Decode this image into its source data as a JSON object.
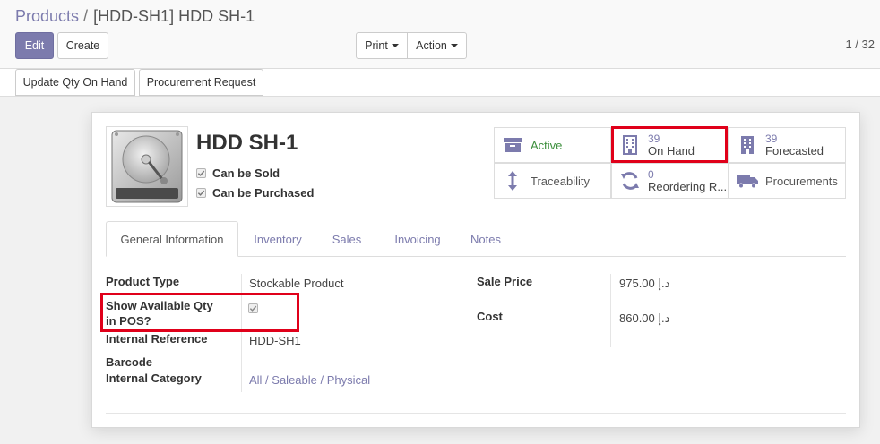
{
  "breadcrumb": {
    "parent": "Products",
    "separator": "/",
    "current": "[HDD-SH1] HDD SH-1"
  },
  "toolbar": {
    "edit_label": "Edit",
    "create_label": "Create",
    "print_label": "Print",
    "action_label": "Action"
  },
  "pager": {
    "value": "1 / 32"
  },
  "statusbar": {
    "update_qty_label": "Update Qty On Hand",
    "procurement_request_label": "Procurement Request"
  },
  "product": {
    "name": "HDD SH-1",
    "can_be_sold_label": "Can be Sold",
    "can_be_purchased_label": "Can be Purchased",
    "can_be_sold": true,
    "can_be_purchased": true
  },
  "smart_buttons": {
    "active_label": "Active",
    "on_hand_count": "39",
    "on_hand_label": "On Hand",
    "forecasted_count": "39",
    "forecasted_label": "Forecasted",
    "traceability_label": "Traceability",
    "reordering_count": "0",
    "reordering_label": "Reordering R...",
    "procurements_label": "Procurements"
  },
  "tabs": [
    "General Information",
    "Inventory",
    "Sales",
    "Invoicing",
    "Notes"
  ],
  "fields": {
    "product_type_label": "Product Type",
    "product_type_value": "Stockable Product",
    "show_qty_pos_label_line1": "Show Available Qty",
    "show_qty_pos_label_line2": "in POS?",
    "show_qty_pos_value": true,
    "internal_reference_label": "Internal Reference",
    "internal_reference_value": "HDD-SH1",
    "barcode_label": "Barcode",
    "barcode_value": "",
    "internal_category_label": "Internal Category",
    "internal_category_value": "All / Saleable / Physical",
    "sale_price_label": "Sale Price",
    "sale_price_value": "975.00 د.إ",
    "cost_label": "Cost",
    "cost_value": "860.00 د.إ"
  },
  "colors": {
    "accent": "#7c7bad",
    "highlight": "#e0001a",
    "active_green": "#3c8f3c"
  },
  "icons": [
    "archive-icon",
    "building-icon",
    "arrows-v-icon",
    "refresh-icon",
    "truck-icon",
    "check-icon",
    "caret-down-icon"
  ]
}
